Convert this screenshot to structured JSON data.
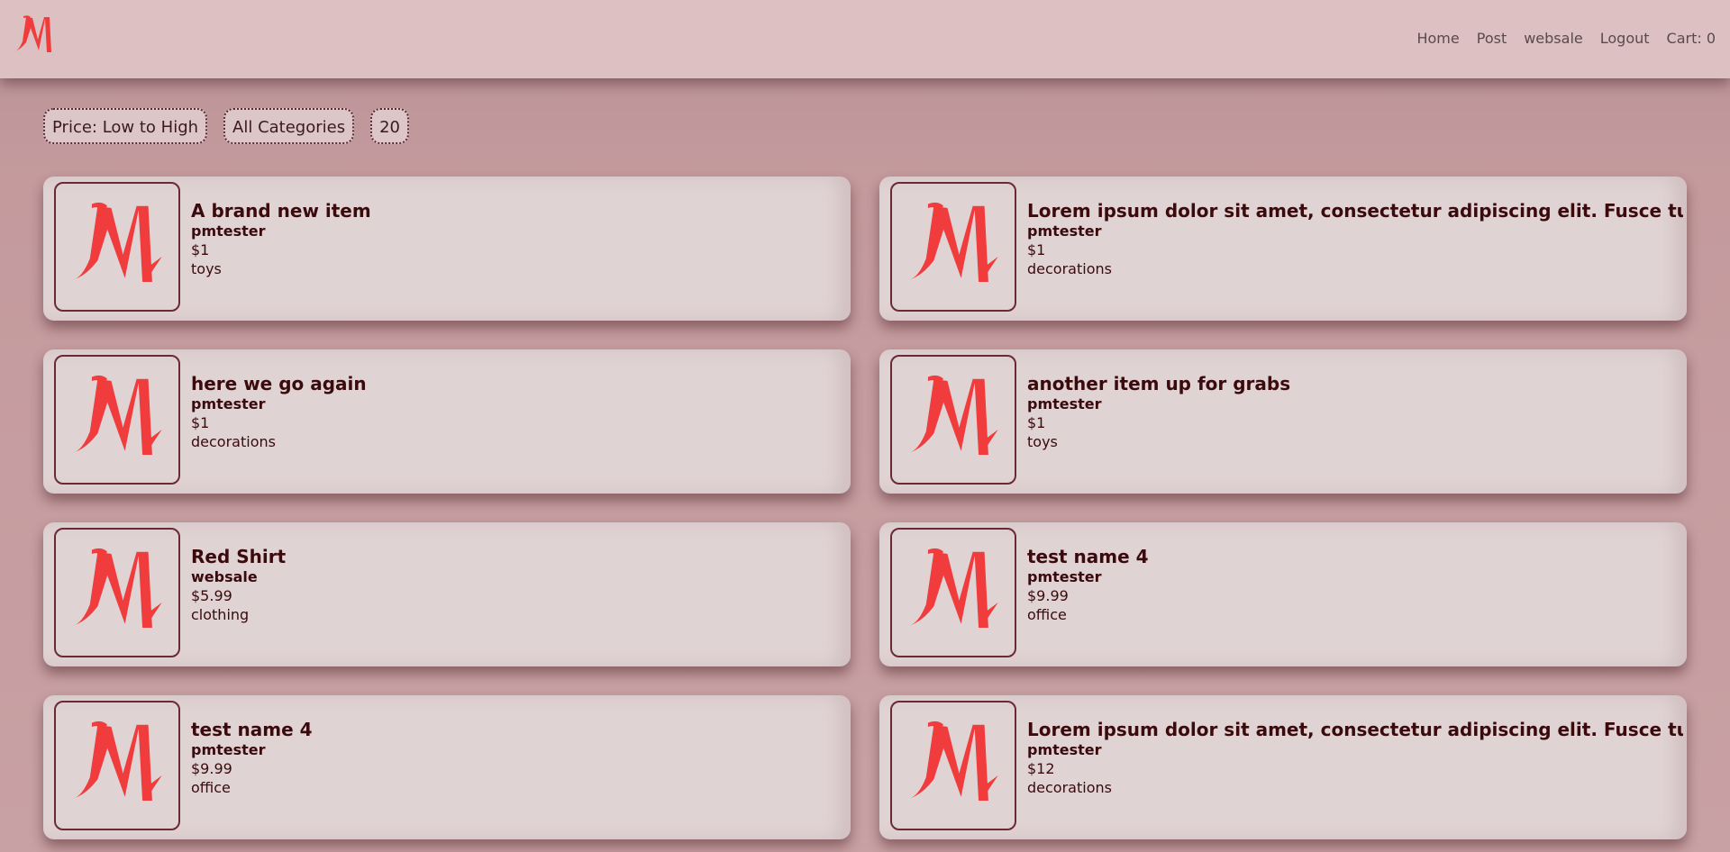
{
  "brand": {
    "logo_icon": "m-logo-icon",
    "accent": "#f03c3c"
  },
  "nav": {
    "items": [
      {
        "label": "Home"
      },
      {
        "label": "Post"
      },
      {
        "label": "websale"
      },
      {
        "label": "Logout"
      },
      {
        "label": "Cart: 0"
      }
    ]
  },
  "filters": {
    "sort": "Price: Low to High",
    "category": "All Categories",
    "per_page": "20"
  },
  "listings": [
    {
      "title": "A brand new item",
      "seller": "pmtester",
      "price": "$1",
      "category": "toys"
    },
    {
      "title": "Lorem ipsum dolor sit amet, consectetur adipiscing elit. Fusce turpis dolo",
      "seller": "pmtester",
      "price": "$1",
      "category": "decorations"
    },
    {
      "title": "here we go again",
      "seller": "pmtester",
      "price": "$1",
      "category": "decorations"
    },
    {
      "title": "another item up for grabs",
      "seller": "pmtester",
      "price": "$1",
      "category": "toys"
    },
    {
      "title": "Red Shirt",
      "seller": "websale",
      "price": "$5.99",
      "category": "clothing"
    },
    {
      "title": "test name 4",
      "seller": "pmtester",
      "price": "$9.99",
      "category": "office"
    },
    {
      "title": "test name 4",
      "seller": "pmtester",
      "price": "$9.99",
      "category": "office"
    },
    {
      "title": "Lorem ipsum dolor sit amet, consectetur adipiscing elit. Fusce turpis dolo",
      "seller": "pmtester",
      "price": "$12",
      "category": "decorations"
    }
  ]
}
